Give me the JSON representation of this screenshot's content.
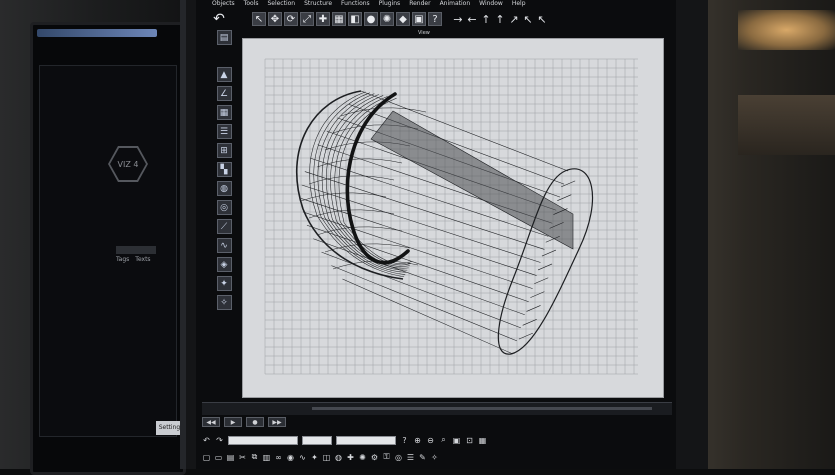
{
  "menu": [
    "Objects",
    "Tools",
    "Selection",
    "Structure",
    "Functions",
    "Plugins",
    "Render",
    "Animation",
    "Window",
    "Help"
  ],
  "viewport_label": "View",
  "left_monitor": {
    "hex_label": "VIZ 4",
    "tabs": [
      "Tags",
      "Texts"
    ],
    "settings_label": "Settings"
  },
  "top_toolbar_icons": [
    "undo-icon",
    "select-arrow-icon",
    "move-icon",
    "rotate-icon",
    "scale-icon",
    "axis-icon",
    "render-icon",
    "cube-icon",
    "sphere-icon",
    "light-icon",
    "camera-icon"
  ],
  "arrow_icons": [
    "→",
    "←",
    "↑",
    "↑",
    "↗",
    "↖",
    "↖"
  ],
  "left_toolbar_icons": [
    "pyramid-icon",
    "angle-icon",
    "grid-icon",
    "stack-icon",
    "lattice-icon",
    "checker-icon",
    "sphere-icon",
    "cylinder-icon",
    "bone-icon",
    "spline-icon",
    "gem-icon",
    "cloth-icon"
  ],
  "colors": {
    "viewport_bg": "#d7d9dc",
    "grid": "#9ea1a5",
    "wire": "#1d1f22",
    "screen_bg": "#0b0c0e"
  }
}
